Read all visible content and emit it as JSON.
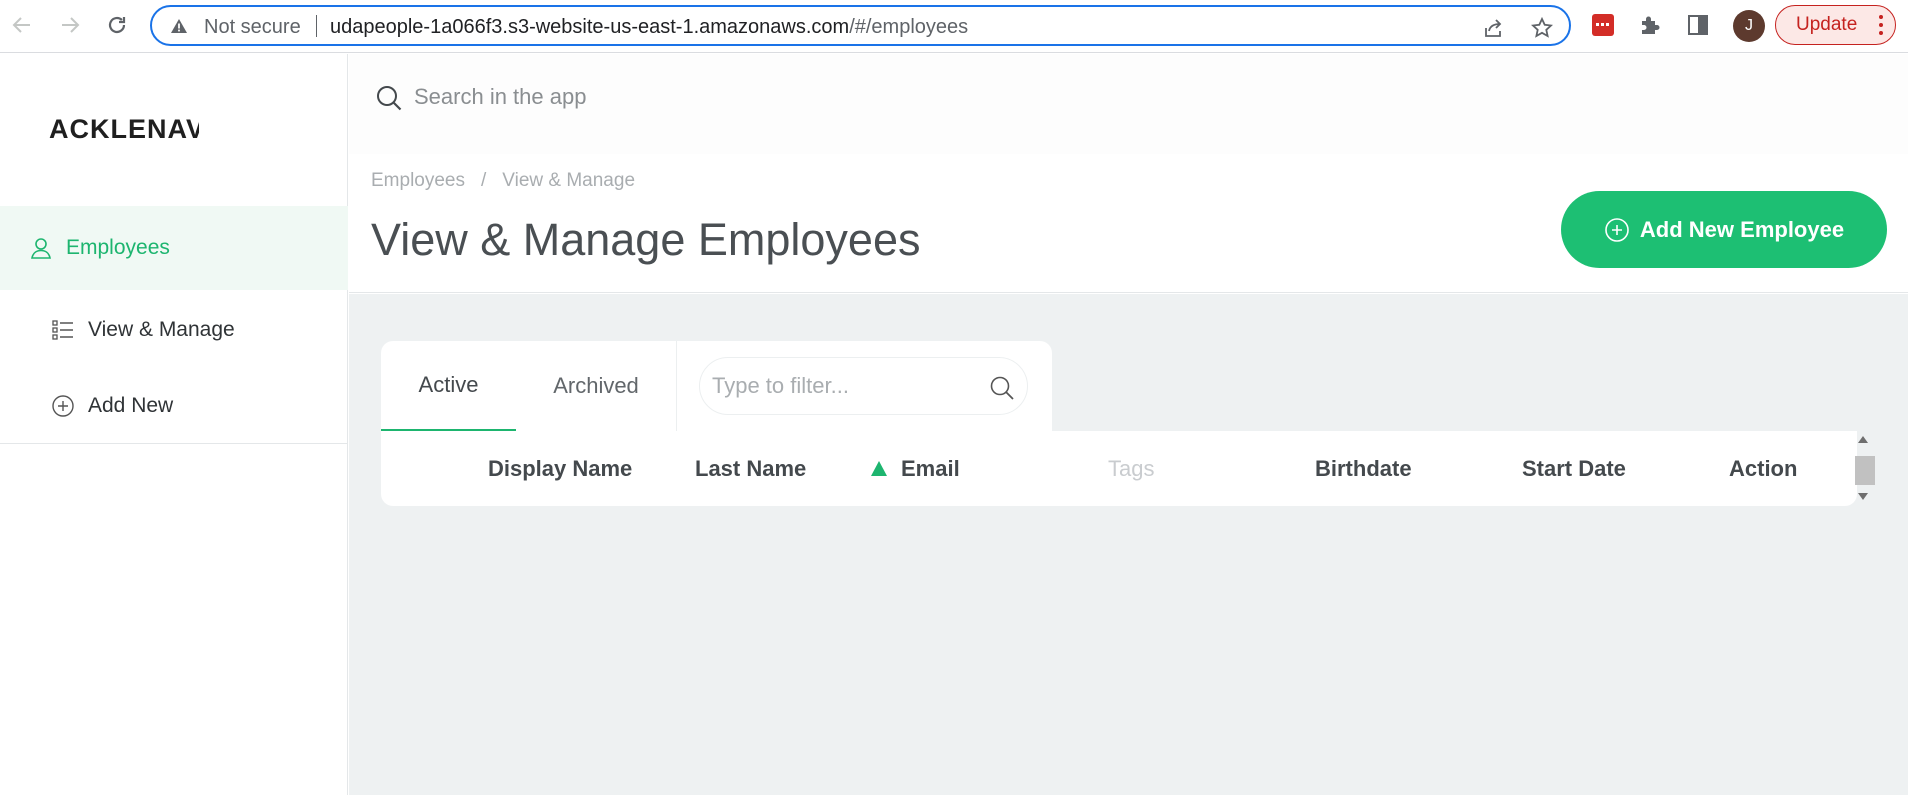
{
  "browser": {
    "security_label": "Not secure",
    "url_host": "udapeople-1a066f3.s3-website-us-east-1.amazonaws.com",
    "url_path": "/#/employees",
    "avatar_initial": "J",
    "update_label": "Update",
    "icons": [
      "back-arrow-icon",
      "forward-arrow-icon",
      "reload-icon",
      "warning-icon",
      "share-icon",
      "star-icon",
      "password-manager-icon",
      "extensions-puzzle-icon",
      "side-panel-icon",
      "kebab-menu-icon"
    ]
  },
  "sidebar": {
    "logo_text": "ACKLENAVENUE",
    "items": [
      {
        "label": "Employees",
        "icon": "user-icon",
        "active": true
      },
      {
        "label": "View & Manage",
        "icon": "list-icon",
        "active": false
      },
      {
        "label": "Add New",
        "icon": "plus-circle-icon",
        "active": false
      }
    ]
  },
  "topbar": {
    "search_placeholder": "Search in the app"
  },
  "header": {
    "breadcrumb": [
      "Employees",
      "View & Manage"
    ],
    "breadcrumb_separator": "/",
    "title": "View & Manage Employees",
    "add_button_label": "Add New Employee"
  },
  "tabs": [
    {
      "label": "Active",
      "active": true
    },
    {
      "label": "Archived",
      "active": false
    }
  ],
  "filter": {
    "placeholder": "Type to filter..."
  },
  "table": {
    "columns": [
      "Display Name",
      "Last Name",
      "Email",
      "Tags",
      "Birthdate",
      "Start Date",
      "Action"
    ],
    "sorted_column": "Email",
    "sort_direction": "ascending"
  },
  "colors": {
    "accent": "#1dbf73",
    "content_bg": "#eef1f2",
    "omnibox_border": "#1a73e8",
    "update_red": "#c5221f"
  }
}
